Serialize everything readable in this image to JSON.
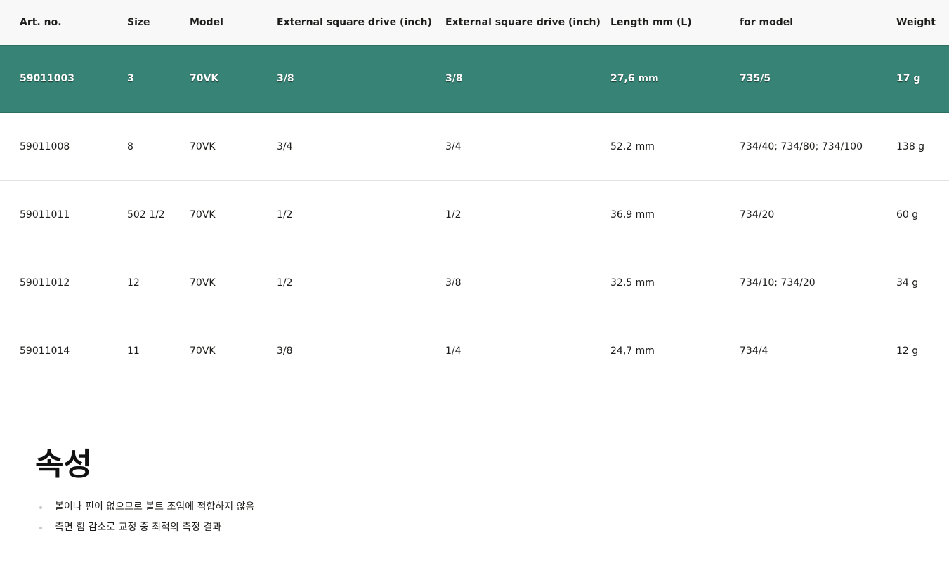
{
  "table": {
    "headers": [
      "Art. no.",
      "Size",
      "Model",
      "External square drive (inch)",
      "External square drive (inch)",
      "Length mm (L)",
      "for model",
      "Weight"
    ],
    "rows": [
      [
        "59011003",
        "3",
        "70VK",
        "3/8",
        "3/8",
        "27,6 mm",
        "735/5",
        "17 g"
      ],
      [
        "59011008",
        "8",
        "70VK",
        "3/4",
        "3/4",
        "52,2 mm",
        "734/40; 734/80; 734/100",
        "138 g"
      ],
      [
        "59011011",
        "502 1/2",
        "70VK",
        "1/2",
        "1/2",
        "36,9 mm",
        "734/20",
        "60 g"
      ],
      [
        "59011012",
        "12",
        "70VK",
        "1/2",
        "3/8",
        "32,5 mm",
        "734/10; 734/20",
        "34 g"
      ],
      [
        "59011014",
        "11",
        "70VK",
        "3/8",
        "1/4",
        "24,7 mm",
        "734/4",
        "12 g"
      ]
    ],
    "selected_row_color": "#378375"
  },
  "properties": {
    "title": "속성",
    "items": [
      "볼이나 핀이 없으므로 볼트 조임에 적합하지 않음",
      "측면 힘 감소로 교정 중 최적의 측정 결과"
    ]
  }
}
